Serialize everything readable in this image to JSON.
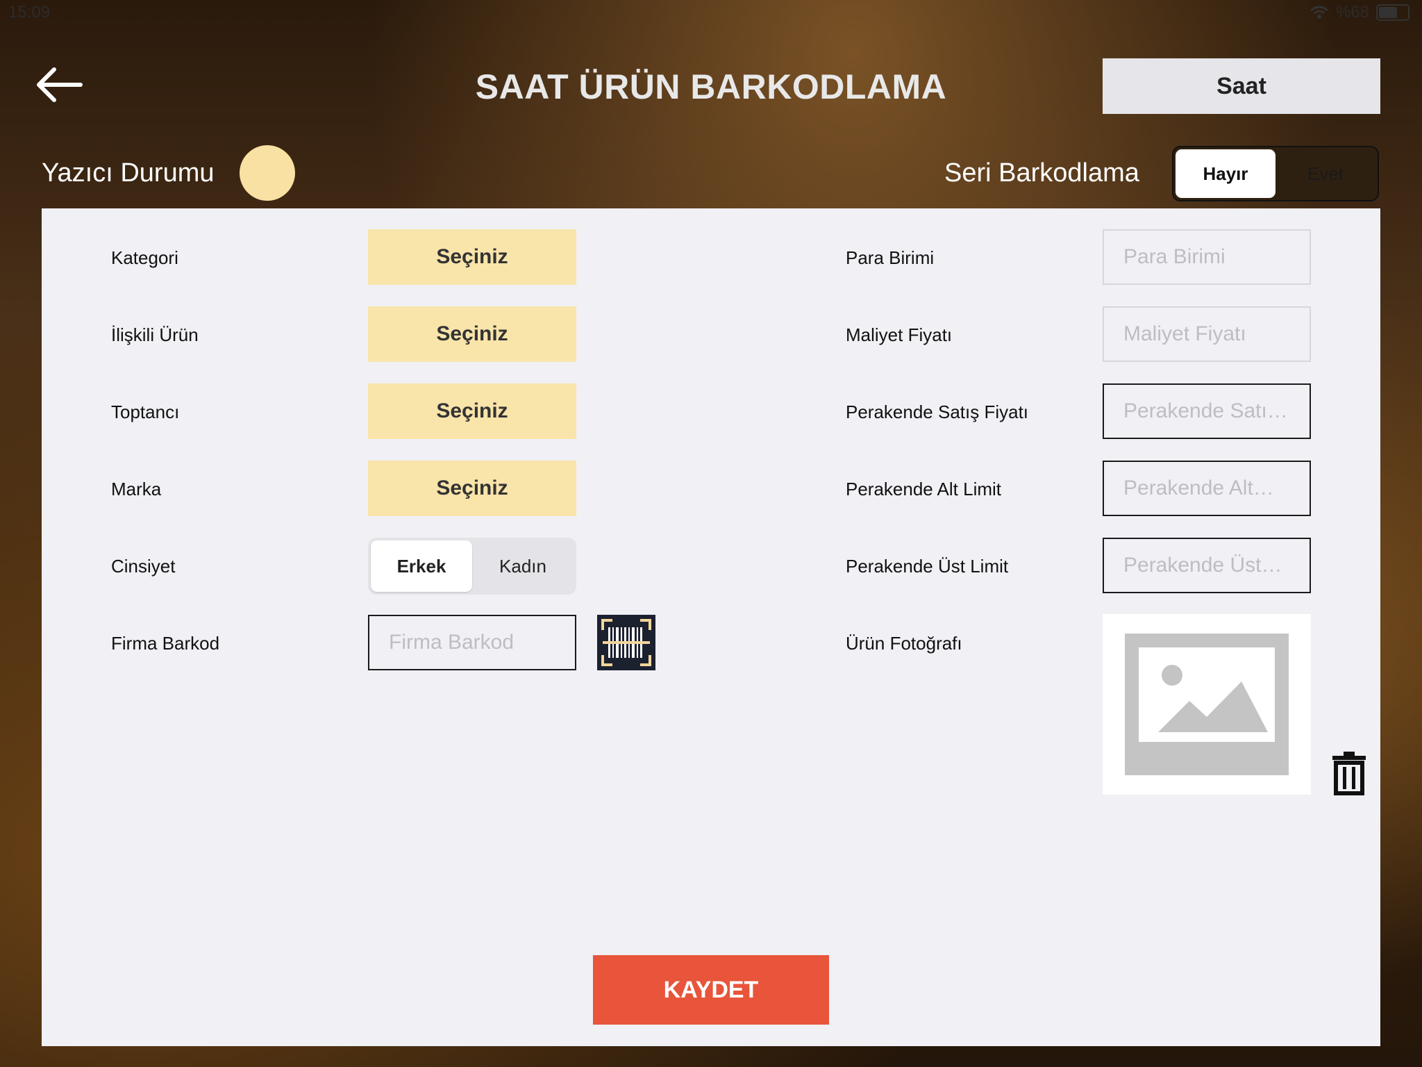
{
  "status_bar": {
    "time": "15:09",
    "battery_text": "%68"
  },
  "header": {
    "title": "SAAT ÜRÜN BARKODLAMA",
    "category_button": "Saat"
  },
  "printer": {
    "label": "Yazıcı Durumu",
    "status_color": "#f9e1a4"
  },
  "serial": {
    "label": "Seri Barkodlama",
    "options": [
      "Hayır",
      "Evet"
    ],
    "selected": "Hayır"
  },
  "left_form": {
    "kategori": {
      "label": "Kategori",
      "value": "Seçiniz"
    },
    "iliskili": {
      "label": "İlişkili Ürün",
      "value": "Seçiniz"
    },
    "toptanci": {
      "label": "Toptancı",
      "value": "Seçiniz"
    },
    "marka": {
      "label": "Marka",
      "value": "Seçiniz"
    },
    "cinsiyet": {
      "label": "Cinsiyet",
      "options": [
        "Erkek",
        "Kadın"
      ],
      "selected": "Erkek"
    },
    "firma_barkod": {
      "label": "Firma Barkod",
      "placeholder": "Firma Barkod"
    }
  },
  "right_form": {
    "para_birimi": {
      "label": "Para Birimi",
      "placeholder": "Para Birimi"
    },
    "maliyet": {
      "label": "Maliyet Fiyatı",
      "placeholder": "Maliyet Fiyatı"
    },
    "perakende_satis": {
      "label": "Perakende Satış Fiyatı",
      "placeholder": "Perakende Satı…"
    },
    "alt_limit": {
      "label": "Perakende Alt Limit",
      "placeholder": "Perakende Alt…"
    },
    "ust_limit": {
      "label": "Perakende Üst Limit",
      "placeholder": "Perakende Üst…"
    },
    "foto": {
      "label": "Ürün Fotoğrafı"
    }
  },
  "save": {
    "label": "KAYDET",
    "color": "#e8553a"
  },
  "icons": [
    "back-arrow-icon",
    "wifi-icon",
    "battery-icon",
    "barcode-scan-icon",
    "image-placeholder-icon",
    "trash-icon"
  ]
}
